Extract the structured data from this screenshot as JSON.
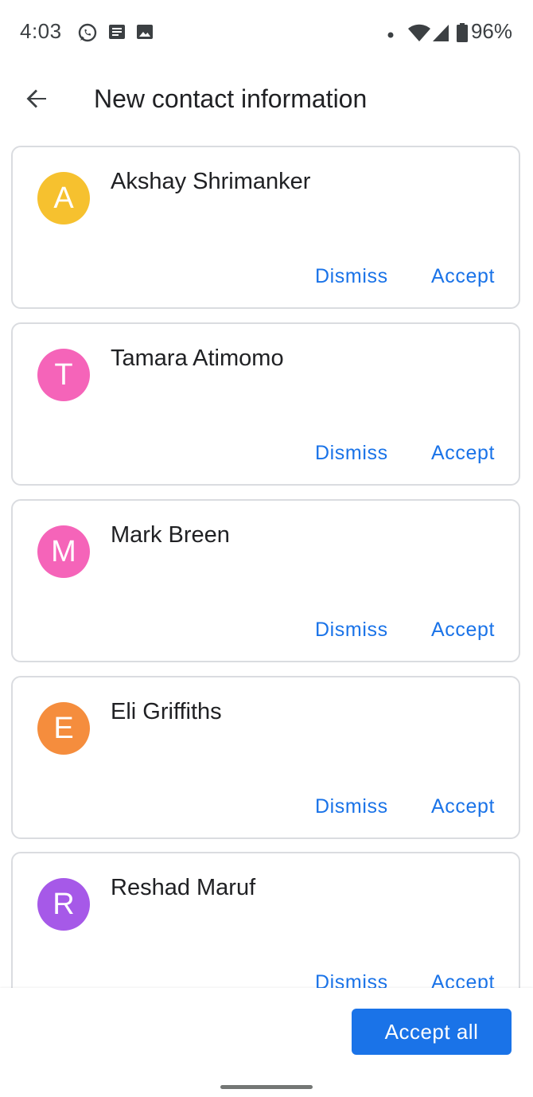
{
  "status_bar": {
    "time": "4:03",
    "battery": "96%",
    "icons": [
      "whatsapp-icon",
      "news-icon",
      "image-icon",
      "dot-icon",
      "wifi-icon",
      "cell-signal-icon",
      "battery-icon"
    ]
  },
  "header": {
    "title": "New contact information",
    "back_icon": "arrow-back-icon"
  },
  "contacts": [
    {
      "initial": "A",
      "name": "Akshay Shrimanker",
      "color": "#f6c12f"
    },
    {
      "initial": "T",
      "name": "Tamara Atimomo",
      "color": "#f564b9"
    },
    {
      "initial": "M",
      "name": "Mark Breen",
      "color": "#f564b9"
    },
    {
      "initial": "E",
      "name": "Eli Griffiths",
      "color": "#f58d3d"
    },
    {
      "initial": "R",
      "name": "Reshad Maruf",
      "color": "#a659e8"
    }
  ],
  "actions": {
    "dismiss_label": "Dismiss",
    "accept_label": "Accept",
    "accept_all_label": "Accept all"
  },
  "colors": {
    "accent": "#1a73e8",
    "card_border": "#dadce0"
  }
}
